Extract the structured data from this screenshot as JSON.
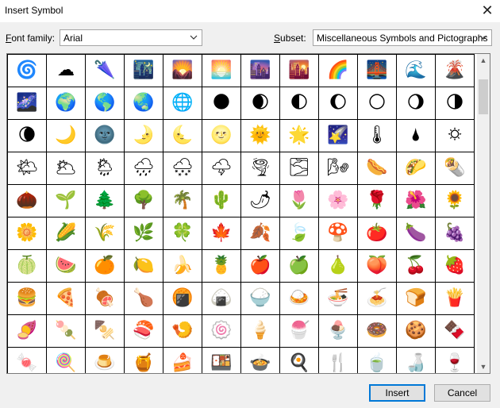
{
  "window": {
    "title": "Insert Symbol",
    "close_glyph": "✕"
  },
  "font_family": {
    "label_accel": "F",
    "label_rest": "ont family:",
    "value": "Arial"
  },
  "subset": {
    "label_accel": "S",
    "label_rest": "ubset:",
    "value": "Miscellaneous Symbols and Pictographs"
  },
  "symbols": [
    [
      "🌀",
      "☁",
      "🌂",
      "🌃",
      "🌄",
      "🌅",
      "🌆",
      "🌇",
      "🌈",
      "🌉",
      "🌊",
      "🌋"
    ],
    [
      "🌌",
      "🌍",
      "🌎",
      "🌏",
      "🌐",
      "🌑",
      "🌒",
      "🌓",
      "🌔",
      "🌕",
      "🌖",
      "🌗"
    ],
    [
      "🌘",
      "🌙",
      "🌚",
      "🌛",
      "🌜",
      "🌝",
      "🌞",
      "🌟",
      "🌠",
      "🌡",
      "🌢",
      "🌣"
    ],
    [
      "🌤",
      "🌥",
      "🌦",
      "🌧",
      "🌨",
      "🌩",
      "🌪",
      "🌫",
      "🌬",
      "🌭",
      "🌮",
      "🌯"
    ],
    [
      "🌰",
      "🌱",
      "🌲",
      "🌳",
      "🌴",
      "🌵",
      "🌶",
      "🌷",
      "🌸",
      "🌹",
      "🌺",
      "🌻"
    ],
    [
      "🌼",
      "🌽",
      "🌾",
      "🌿",
      "🍀",
      "🍁",
      "🍂",
      "🍃",
      "🍄",
      "🍅",
      "🍆",
      "🍇"
    ],
    [
      "🍈",
      "🍉",
      "🍊",
      "🍋",
      "🍌",
      "🍍",
      "🍎",
      "🍏",
      "🍐",
      "🍑",
      "🍒",
      "🍓"
    ],
    [
      "🍔",
      "🍕",
      "🍖",
      "🍗",
      "🍘",
      "🍙",
      "🍚",
      "🍛",
      "🍜",
      "🍝",
      "🍞",
      "🍟"
    ],
    [
      "🍠",
      "🍡",
      "🍢",
      "🍣",
      "🍤",
      "🍥",
      "🍦",
      "🍧",
      "🍨",
      "🍩",
      "🍪",
      "🍫"
    ],
    [
      "🍬",
      "🍭",
      "🍮",
      "🍯",
      "🍰",
      "🍱",
      "🍲",
      "🍳",
      "🍴",
      "🍵",
      "🍶",
      "🍷"
    ]
  ],
  "buttons": {
    "insert": "Insert",
    "cancel": "Cancel"
  },
  "icons": {
    "scroll_up": "▲",
    "scroll_down": "▼"
  }
}
